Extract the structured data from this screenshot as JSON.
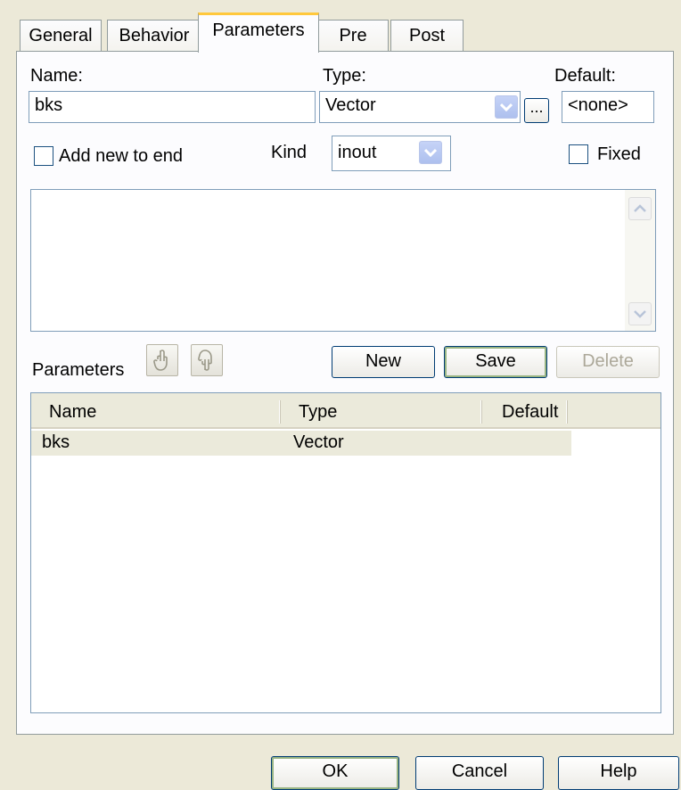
{
  "tabs": [
    {
      "label": "General"
    },
    {
      "label": "Behavior"
    },
    {
      "label": "Parameters"
    },
    {
      "label": "Pre"
    },
    {
      "label": "Post"
    }
  ],
  "form": {
    "name_label": "Name:",
    "name_value": "bks",
    "type_label": "Type:",
    "type_value": "Vector",
    "browse_label": "...",
    "default_label": "Default:",
    "default_value": "<none>",
    "add_new_label": "Add new to end",
    "kind_label": "Kind",
    "kind_value": "inout",
    "fixed_label": "Fixed",
    "notes_value": ""
  },
  "toolbar": {
    "parameters_label": "Parameters",
    "new_label": "New",
    "save_label": "Save",
    "delete_label": "Delete"
  },
  "list": {
    "columns": [
      "Name",
      "Type",
      "Default"
    ],
    "rows": [
      {
        "name": "bks",
        "type": "Vector",
        "default": ""
      }
    ]
  },
  "footer": {
    "ok_label": "OK",
    "cancel_label": "Cancel",
    "help_label": "Help"
  },
  "colors": {
    "background": "#ece9d8",
    "active_tab_accent": "#ffc83c",
    "border": "#7f9db9",
    "dropdown_button": "#b1c3ef"
  },
  "icons": {
    "move_up": "hand-up-icon",
    "move_down": "hand-down-icon",
    "dropdown": "chevron-down-icon"
  }
}
